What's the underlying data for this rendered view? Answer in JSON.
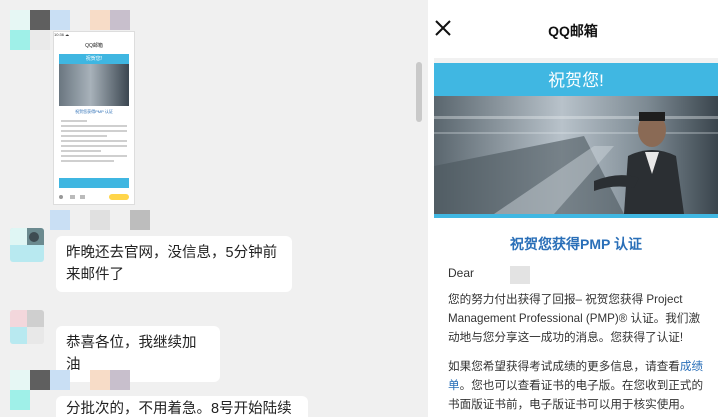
{
  "chat": {
    "messages": [
      {
        "text": "昨晚还去官网，没信息，5分钟前来邮件了"
      },
      {
        "text": "恭喜各位，我继续加油"
      },
      {
        "text": "分批次的，不用着急。8号开始陆续"
      }
    ],
    "thumbnail": {
      "status_bar": "10:36 ☁",
      "header": "QQ邮箱",
      "banner": "祝贺您!",
      "title": "祝贺您获得PMP 认证"
    }
  },
  "email": {
    "app_title": "QQ邮箱",
    "banner": "祝贺您!",
    "heading": "祝贺您获得PMP 认证",
    "greeting": "Dear",
    "para1": "您的努力付出获得了回报– 祝贺您获得 Project Management Professional (PMP)® 认证。我们激动地与您分享这一成功的消息。您获得了认证!",
    "para2_before": "如果您希望获得考试成绩的更多信息，请查看",
    "para2_link": "成绩单",
    "para2_after": "。您也可以查看证书的电子版。在您收到正式的书面版证书前，电子版证书可以用于核实使用。"
  },
  "colors": {
    "accent": "#40b7e2",
    "link": "#2a6fb8"
  }
}
